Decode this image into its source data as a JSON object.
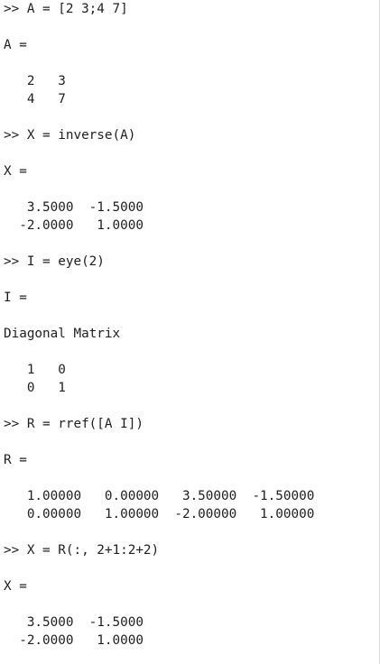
{
  "console": {
    "lines": [
      ">> A = [2 3;4 7]",
      "",
      "A =",
      "",
      "   2   3",
      "   4   7",
      "",
      ">> X = inverse(A)",
      "",
      "X =",
      "",
      "   3.5000  -1.5000",
      "  -2.0000   1.0000",
      "",
      ">> I = eye(2)",
      "",
      "I =",
      "",
      "Diagonal Matrix",
      "",
      "   1   0",
      "   0   1",
      "",
      ">> R = rref([A I])",
      "",
      "R =",
      "",
      "   1.00000   0.00000   3.50000  -1.50000",
      "   0.00000   1.00000  -2.00000   1.00000",
      "",
      ">> X = R(:, 2+1:2+2)",
      "",
      "X =",
      "",
      "   3.5000  -1.5000",
      "  -2.0000   1.0000"
    ]
  }
}
